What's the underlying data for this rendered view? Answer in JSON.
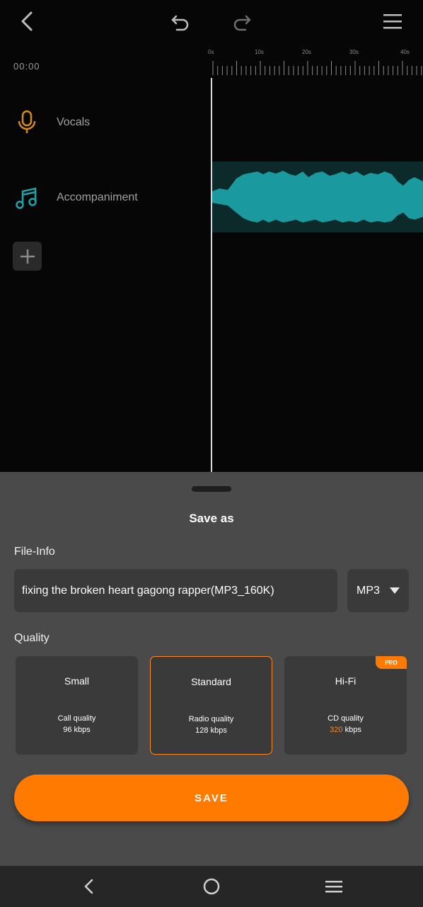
{
  "toolbar": {
    "back_icon": "chevron-left-icon",
    "undo_icon": "undo-icon",
    "redo_icon": "redo-icon",
    "menu_icon": "hamburger-menu-icon"
  },
  "timeline": {
    "current_time": "00:00",
    "ruler_labels": [
      "0s",
      "10s",
      "20s",
      "30s",
      "40s"
    ]
  },
  "tracks": [
    {
      "label": "Vocals",
      "icon": "microphone-icon",
      "color": "#d4891f"
    },
    {
      "label": "Accompaniment",
      "icon": "music-note-icon",
      "color": "#1aa3a8"
    }
  ],
  "waveform_color": "#1a9a9f",
  "save_sheet": {
    "title": "Save as",
    "file_info_label": "File-Info",
    "file_name": "fixing the broken heart gagong rapper(MP3_160K)",
    "format": "MP3",
    "quality_label": "Quality",
    "options": [
      {
        "title": "Small",
        "desc": "Call quality",
        "bitrate_num": "96",
        "bitrate_unit": " kbps"
      },
      {
        "title": "Standard",
        "desc": "Radio quality",
        "bitrate_num": "128",
        "bitrate_unit": " kbps",
        "selected": true
      },
      {
        "title": "Hi-Fi",
        "desc": "CD quality",
        "bitrate_num": "320",
        "bitrate_unit": " kbps",
        "badge": "PRO"
      }
    ],
    "save_label": "SAVE",
    "accent_color": "#ff7a00"
  },
  "navbar": {
    "back_icon": "nav-back-icon",
    "home_icon": "nav-home-icon",
    "recents_icon": "nav-menu-icon"
  }
}
